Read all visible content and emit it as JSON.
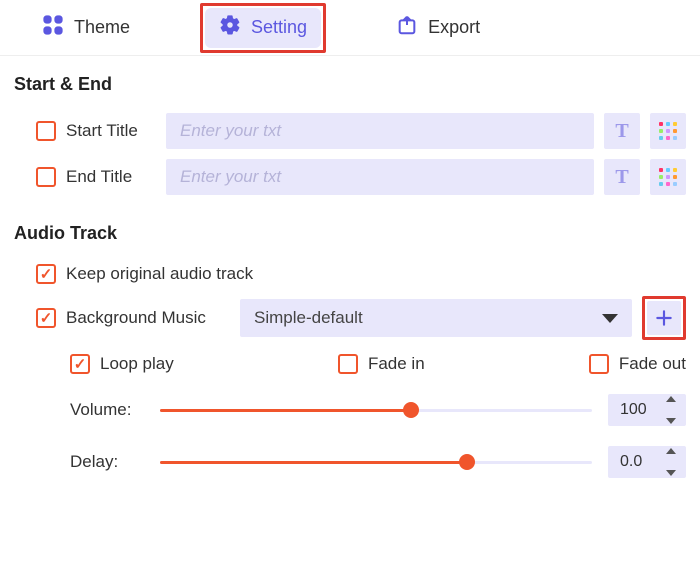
{
  "tabs": {
    "theme": "Theme",
    "setting": "Setting",
    "export": "Export",
    "active": "setting"
  },
  "sections": {
    "start_end": "Start & End",
    "audio_track": "Audio Track"
  },
  "start_end": {
    "start_title_label": "Start Title",
    "end_title_label": "End Title",
    "placeholder": "Enter your txt"
  },
  "audio": {
    "keep_original_label": "Keep original audio track",
    "keep_original_checked": true,
    "bgm_label": "Background Music",
    "bgm_checked": true,
    "bgm_selected": "Simple-default",
    "loop_label": "Loop play",
    "loop_checked": true,
    "fade_in_label": "Fade in",
    "fade_in_checked": false,
    "fade_out_label": "Fade out",
    "fade_out_checked": false,
    "volume_label": "Volume:",
    "volume_value": "100",
    "volume_percent": 58,
    "delay_label": "Delay:",
    "delay_value": "0.0",
    "delay_percent": 71
  },
  "colors": {
    "accent": "#5b57e0",
    "orange": "#f0552c",
    "panel": "#e8e7fb"
  }
}
